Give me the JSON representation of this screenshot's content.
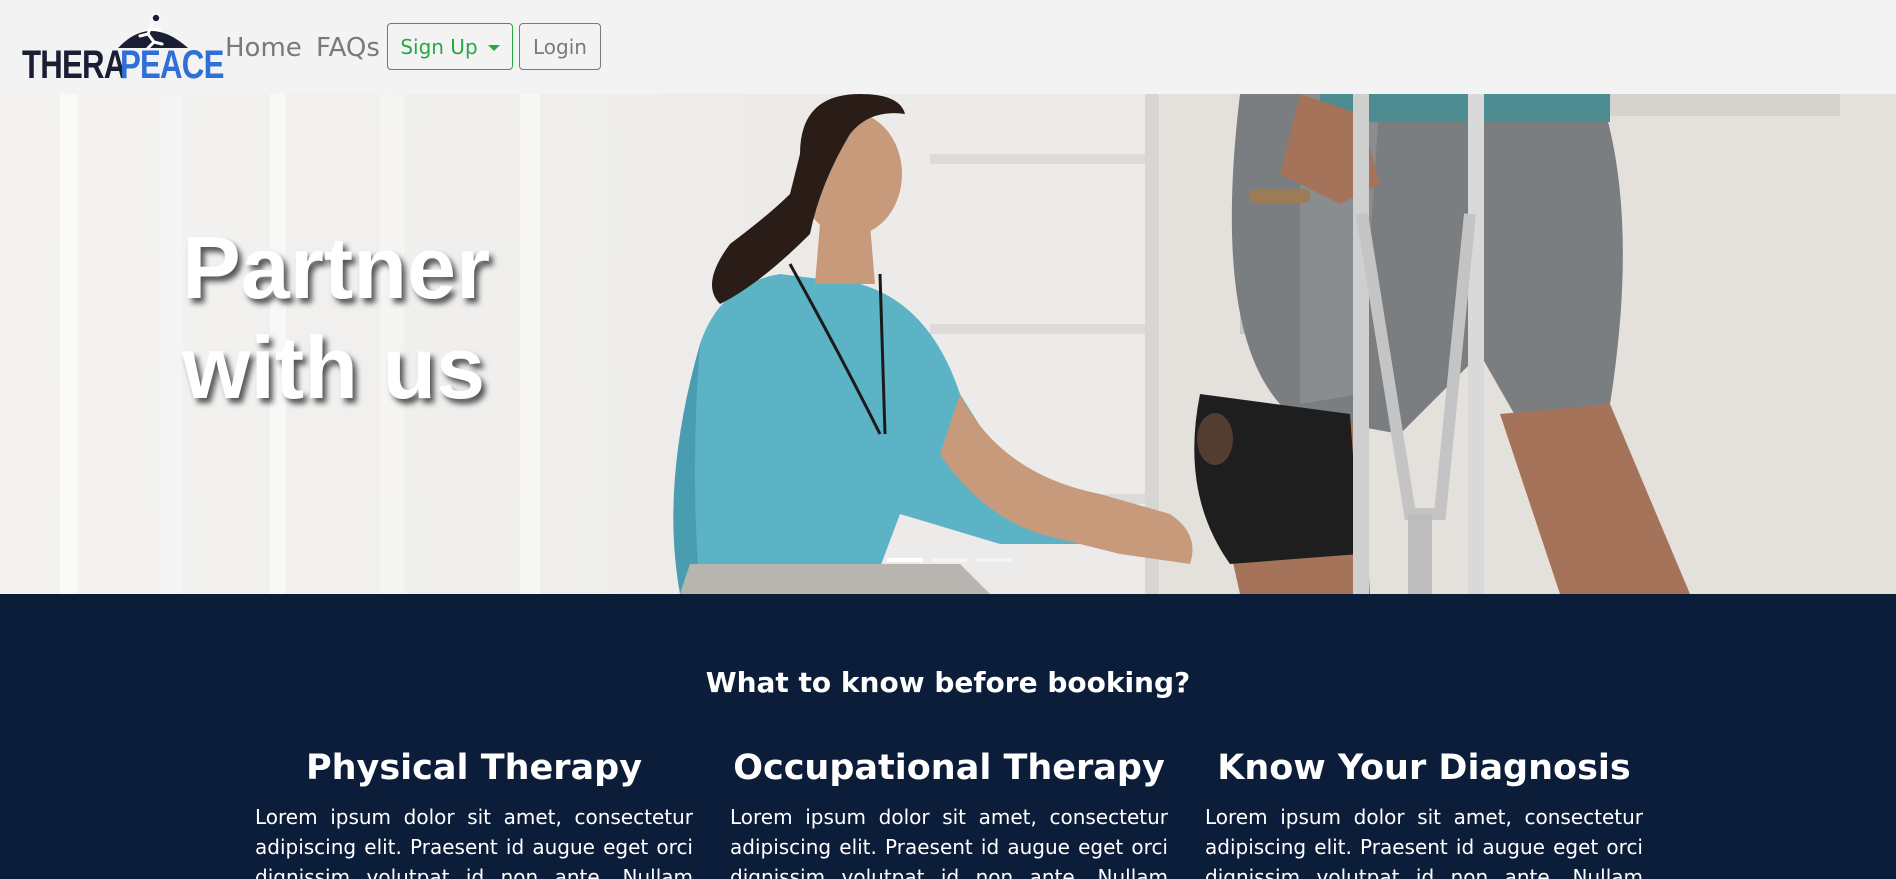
{
  "navbar": {
    "brand": {
      "part1": "THERA",
      "part2": "PEACE"
    },
    "links": {
      "home": "Home",
      "faqs": "FAQs"
    },
    "signup_label": "Sign Up",
    "login_label": "Login"
  },
  "hero": {
    "title_line1": "Partner",
    "title_line2": "with us",
    "slides": 3,
    "active_slide": 1
  },
  "info": {
    "heading": "What to know before booking?",
    "columns": [
      {
        "title": "Physical Therapy",
        "text": "Lorem ipsum dolor sit amet, consectetur adipiscing elit. Praesent id augue eget orci dignissim volutpat id non ante. Nullam sodales"
      },
      {
        "title": "Occupational Therapy",
        "text": "Lorem ipsum dolor sit amet, consectetur adipiscing elit. Praesent id augue eget orci dignissim volutpat id non ante. Nullam sodales"
      },
      {
        "title": "Know Your Diagnosis",
        "text": "Lorem ipsum dolor sit amet, consectetur adipiscing elit. Praesent id augue eget orci dignissim volutpat id non ante. Nullam sodales"
      }
    ]
  },
  "colors": {
    "navbar_bg": "#f3f3f3",
    "brand_dark": "#1a1f35",
    "brand_blue": "#2f6fd8",
    "signup_green": "#28a745",
    "section_bg": "#0c1d3a"
  }
}
